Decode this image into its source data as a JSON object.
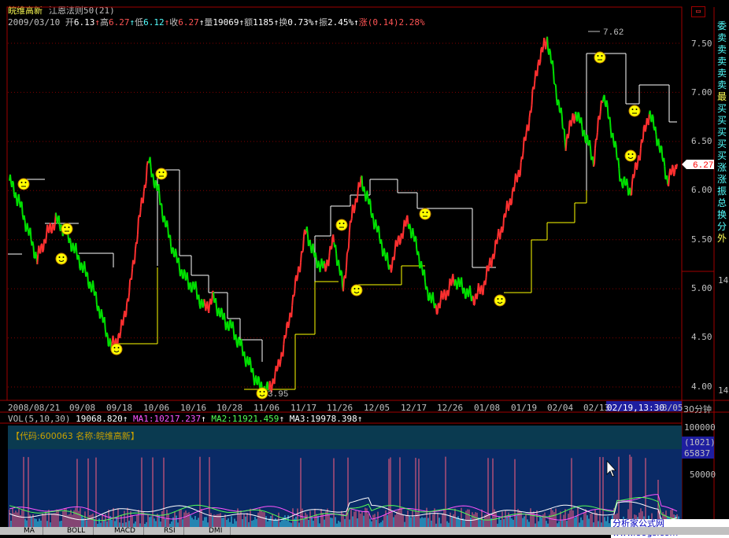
{
  "header": {
    "stock_name": "皖维高新",
    "formula": "江恩法则50(21)",
    "quote_line": {
      "date": "2009/03/10",
      "open_label": "开",
      "open": "6.13",
      "high_label": "高",
      "high": "6.27",
      "low_label": "低",
      "low": "6.12",
      "close_label": "收",
      "close": "6.27",
      "volume_label": "量",
      "volume": "19069",
      "amount_label": "额",
      "amount": "1185",
      "turnover_label": "换",
      "turnover": "0.73%",
      "amplitude_label": "振",
      "amplitude": "2.45%",
      "change_label": "涨",
      "change": "(0.14)",
      "change_pct": "2.28%"
    }
  },
  "price_axis": {
    "labels": [
      "7.50",
      "7.00",
      "6.50",
      "6.00",
      "5.50",
      "5.00",
      "4.50",
      "4.00"
    ],
    "current_price_tag": "6.27",
    "high_annotation": "7.62",
    "low_annotation": "3.95"
  },
  "date_axis": {
    "labels": [
      "2008/08/21",
      "09/08",
      "09/18",
      "10/06",
      "10/16",
      "10/28",
      "11/06",
      "11/17",
      "11/26",
      "12/05",
      "12/17",
      "12/26",
      "01/08",
      "01/19",
      "02/04",
      "02/13"
    ],
    "cursor_time": "02/19,13:30",
    "last_label": "3/05",
    "period": "30分钟"
  },
  "side_panel": {
    "top_icon": "restore-window-icon",
    "labels": [
      "委",
      "卖",
      "卖",
      "卖",
      "卖",
      "卖",
      "最",
      "买",
      "买",
      "买",
      "买",
      "买",
      "涨",
      "涨",
      "振",
      "总",
      "换",
      "分",
      "外"
    ],
    "number_a": "14",
    "number_b": "14"
  },
  "volume_panel": {
    "indicator_line": "VOL(5,10,30)",
    "vol": "19068.820",
    "ma1_label": "MA1:",
    "ma1": "10217.237",
    "ma2_label": "MA2:",
    "ma2": "11921.459",
    "ma3_label": "MA3:",
    "ma3": "19978.398",
    "info_box": "【代码:600063 名称:皖维高新】",
    "axis_top": "100000",
    "axis_mid": "50000",
    "cursor_box_a": "(1021)",
    "cursor_box_b": "65837"
  },
  "footer": {
    "watermark": "分析家公式网www.88gs.com",
    "tabs": [
      "MA",
      "BOLL",
      "MACD",
      "RSI",
      "DMI"
    ]
  },
  "colors": {
    "up": "#ff3030",
    "down": "#00e000",
    "frame": "#a00000",
    "grid": "#800000",
    "stair": "#ffffff",
    "stair_support": "#ffff00",
    "volume_bg": "#0a2860"
  },
  "chart_data": {
    "type": "line",
    "ylim": [
      3.9,
      7.8
    ],
    "price_series": [
      [
        6.1,
        5.9,
        5.6,
        5.3,
        5.55,
        5.7,
        5.6,
        5.4,
        5.2,
        5.0,
        4.7,
        4.4,
        4.55,
        5.0,
        5.7,
        6.3,
        6.0,
        5.6,
        5.3,
        5.1,
        5.0,
        4.8,
        4.9,
        4.7,
        4.6,
        4.4,
        4.2,
        4.0,
        3.97,
        4.2,
        4.6,
        5.1,
        5.6,
        5.3,
        5.2,
        5.5,
        5.0,
        5.8,
        6.1,
        5.8,
        5.5,
        5.2,
        5.5,
        5.7,
        5.4,
        5.0,
        4.8,
        4.95,
        5.1,
        5.0,
        4.9,
        5.0,
        5.3,
        5.6,
        5.9,
        6.2,
        6.7,
        7.3,
        7.55,
        7.0,
        6.5,
        6.8,
        6.6,
        6.3,
        7.0,
        6.6,
        6.1,
        6.0,
        6.4,
        6.8,
        6.5,
        6.1,
        6.27
      ]
    ],
    "volume_ma_axis": [
      "100000",
      "50000"
    ]
  }
}
